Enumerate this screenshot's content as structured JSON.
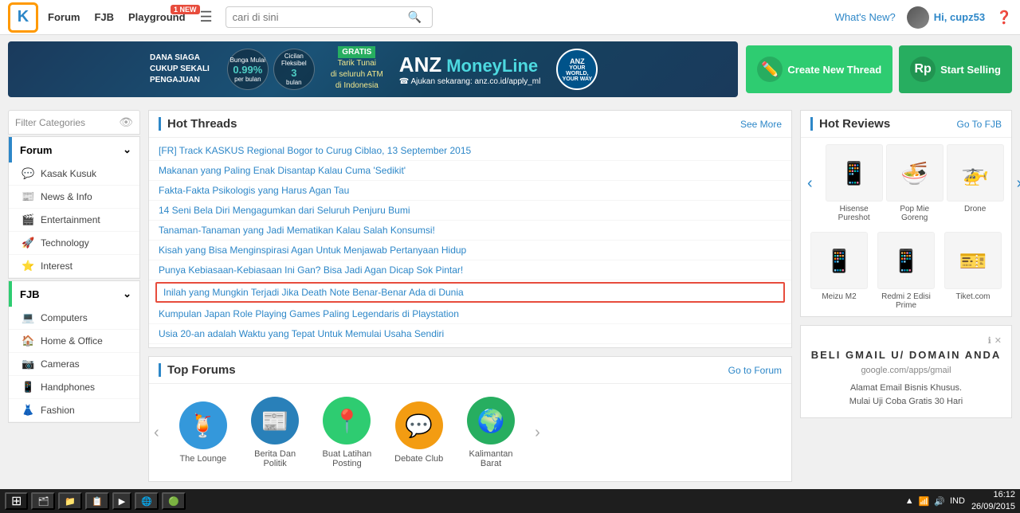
{
  "nav": {
    "logo": "K",
    "forum": "Forum",
    "fjb": "FJB",
    "playground": "Playground",
    "new_badge": "1 NEW",
    "search_placeholder": "cari di sini",
    "whats_new": "What's New?",
    "username": "Hi, cupz53",
    "help": "?"
  },
  "action_buttons": {
    "create_thread": "Create New Thread",
    "start_selling": "Start Selling"
  },
  "sidebar": {
    "filter_label": "Filter Categories",
    "forum_section": "Forum",
    "forum_items": [
      {
        "icon": "💬",
        "label": "Kasak Kusuk"
      },
      {
        "icon": "📰",
        "label": "News & Info"
      },
      {
        "icon": "🎬",
        "label": "Entertainment"
      },
      {
        "icon": "🚀",
        "label": "Technology"
      },
      {
        "icon": "⭐",
        "label": "Interest"
      }
    ],
    "fjb_section": "FJB",
    "fjb_items": [
      {
        "icon": "💻",
        "label": "Computers"
      },
      {
        "icon": "🏠",
        "label": "Home & Office"
      },
      {
        "icon": "📷",
        "label": "Cameras"
      },
      {
        "icon": "📱",
        "label": "Handphones"
      },
      {
        "icon": "👗",
        "label": "Fashion"
      }
    ]
  },
  "hot_threads": {
    "title": "Hot Threads",
    "see_more": "See More",
    "threads": [
      {
        "text": "[FR] Track KASKUS Regional Bogor to Curug Ciblao, 13 September 2015",
        "highlighted": false
      },
      {
        "text": "Makanan yang Paling Enak Disantap Kalau Cuma 'Sedikit'",
        "highlighted": false
      },
      {
        "text": "Fakta-Fakta Psikologis yang Harus Agan Tau",
        "highlighted": false
      },
      {
        "text": "14 Seni Bela Diri Mengagumkan dari Seluruh Penjuru Bumi",
        "highlighted": false
      },
      {
        "text": "Tanaman-Tanaman yang Jadi Mematikan Kalau Salah Konsumsi!",
        "highlighted": false
      },
      {
        "text": "Kisah yang Bisa Menginspirasi Agan Untuk Menjawab Pertanyaan Hidup",
        "highlighted": false
      },
      {
        "text": "Punya Kebiasaan-Kebiasaan Ini Gan? Bisa Jadi Agan Dicap Sok Pintar!",
        "highlighted": false
      },
      {
        "text": "Inilah yang Mungkin Terjadi Jika Death Note Benar-Benar Ada di Dunia",
        "highlighted": true
      },
      {
        "text": "Kumpulan Japan Role Playing Games Paling Legendaris di Playstation",
        "highlighted": false
      },
      {
        "text": "Usia 20-an adalah Waktu yang Tepat Untuk Memulai Usaha Sendiri",
        "highlighted": false
      }
    ]
  },
  "top_forums": {
    "title": "Top Forums",
    "go_to_forum": "Go to Forum",
    "forums": [
      {
        "label": "The Lounge",
        "icon_color": "#3498db",
        "icon_emoji": "🍹"
      },
      {
        "label": "Berita Dan Politik",
        "icon_color": "#2980b9",
        "icon_emoji": "📰"
      },
      {
        "label": "Buat Latihan Posting",
        "icon_color": "#2ecc71",
        "icon_emoji": "📍"
      },
      {
        "label": "Debate Club",
        "icon_color": "#f39c12",
        "icon_emoji": "💬"
      },
      {
        "label": "Kalimantan Barat",
        "icon_color": "#27ae60",
        "icon_emoji": "🌍"
      }
    ]
  },
  "hot_reviews": {
    "title": "Hot Reviews",
    "go_fjb": "Go To FJB",
    "row1": [
      {
        "label": "Hisense Pureshot",
        "emoji": "📱"
      },
      {
        "label": "Pop Mie Goreng",
        "emoji": "🍜"
      },
      {
        "label": "Drone",
        "emoji": "🚁"
      }
    ],
    "row2": [
      {
        "label": "Meizu M2",
        "emoji": "📱"
      },
      {
        "label": "Redmi 2 Edisi Prime",
        "emoji": "📱"
      },
      {
        "label": "Tiket.com",
        "emoji": "🎫"
      }
    ]
  },
  "ad": {
    "title": "BELI GMAIL U/ DOMAIN ANDA",
    "url": "google.com/apps/gmail",
    "line1": "Alamat Email Bisnis Khusus.",
    "line2": "Mulai Uji Coba Gratis 30 Hari"
  },
  "taskbar": {
    "time": "16:12",
    "date": "26/09/2015",
    "language": "IND"
  }
}
